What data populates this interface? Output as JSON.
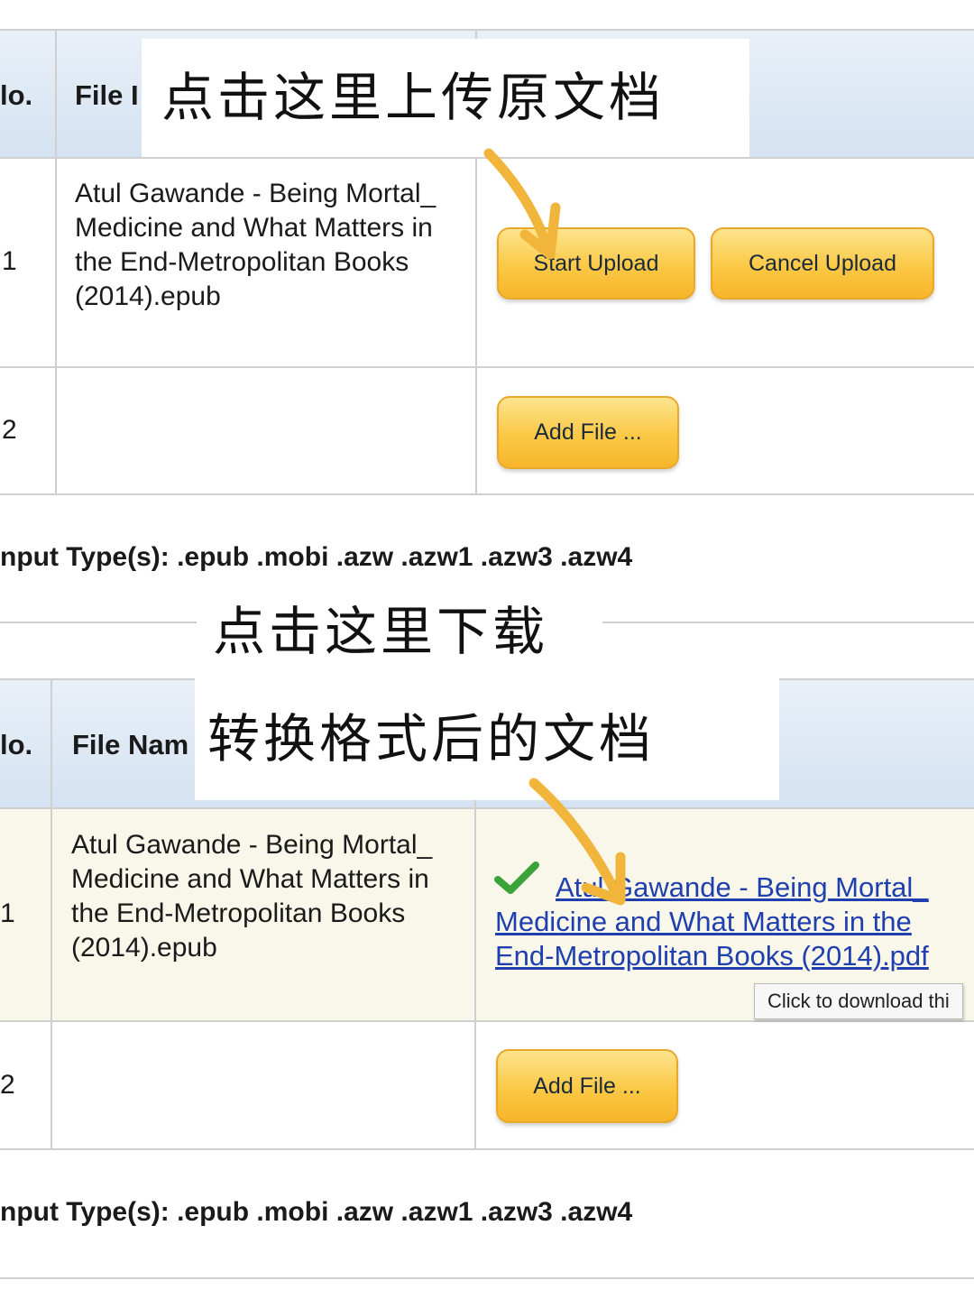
{
  "section_top": {
    "header": {
      "no_label": "lo.",
      "file_label": "File I"
    },
    "rows": [
      {
        "num": "1",
        "file_name": "Atul Gawande - Being Mortal_ Medicine and What Matters in the End-Metropolitan Books (2014).epub"
      },
      {
        "num": "2",
        "file_name": ""
      }
    ],
    "start_upload": "Start Upload",
    "cancel_upload": "Cancel Upload",
    "add_file": "Add File ...",
    "input_types": "nput Type(s): .epub .mobi .azw .azw1 .azw3 .azw4"
  },
  "section_bottom": {
    "header": {
      "no_label": "lo.",
      "file_label": "File Nam"
    },
    "rows": [
      {
        "num": "1",
        "file_name": "Atul Gawande - Being Mortal_ Medicine and What Matters in the End-Metropolitan Books (2014).epub"
      },
      {
        "num": "2",
        "file_name": ""
      }
    ],
    "download_link": "Atul Gawande - Being Mortal_ Medicine and What Matters in the End-Metropolitan Books (2014).pdf",
    "tooltip": "Click to download thi",
    "add_file": "Add File ...",
    "input_types": "nput Type(s): .epub .mobi .azw .azw1 .azw3 .azw4"
  },
  "annotations": {
    "upload_note": "点击这里上传原文档",
    "download_note_line1": "点击这里下载",
    "download_note_line2": "转换格式后的文档"
  },
  "icons": {
    "arrow": "arrow-icon",
    "check": "checkmark-icon"
  },
  "colors": {
    "arrow": "#f0b53a",
    "check": "#3aa33a",
    "link": "#1f3fae",
    "button": "#fbc845"
  }
}
